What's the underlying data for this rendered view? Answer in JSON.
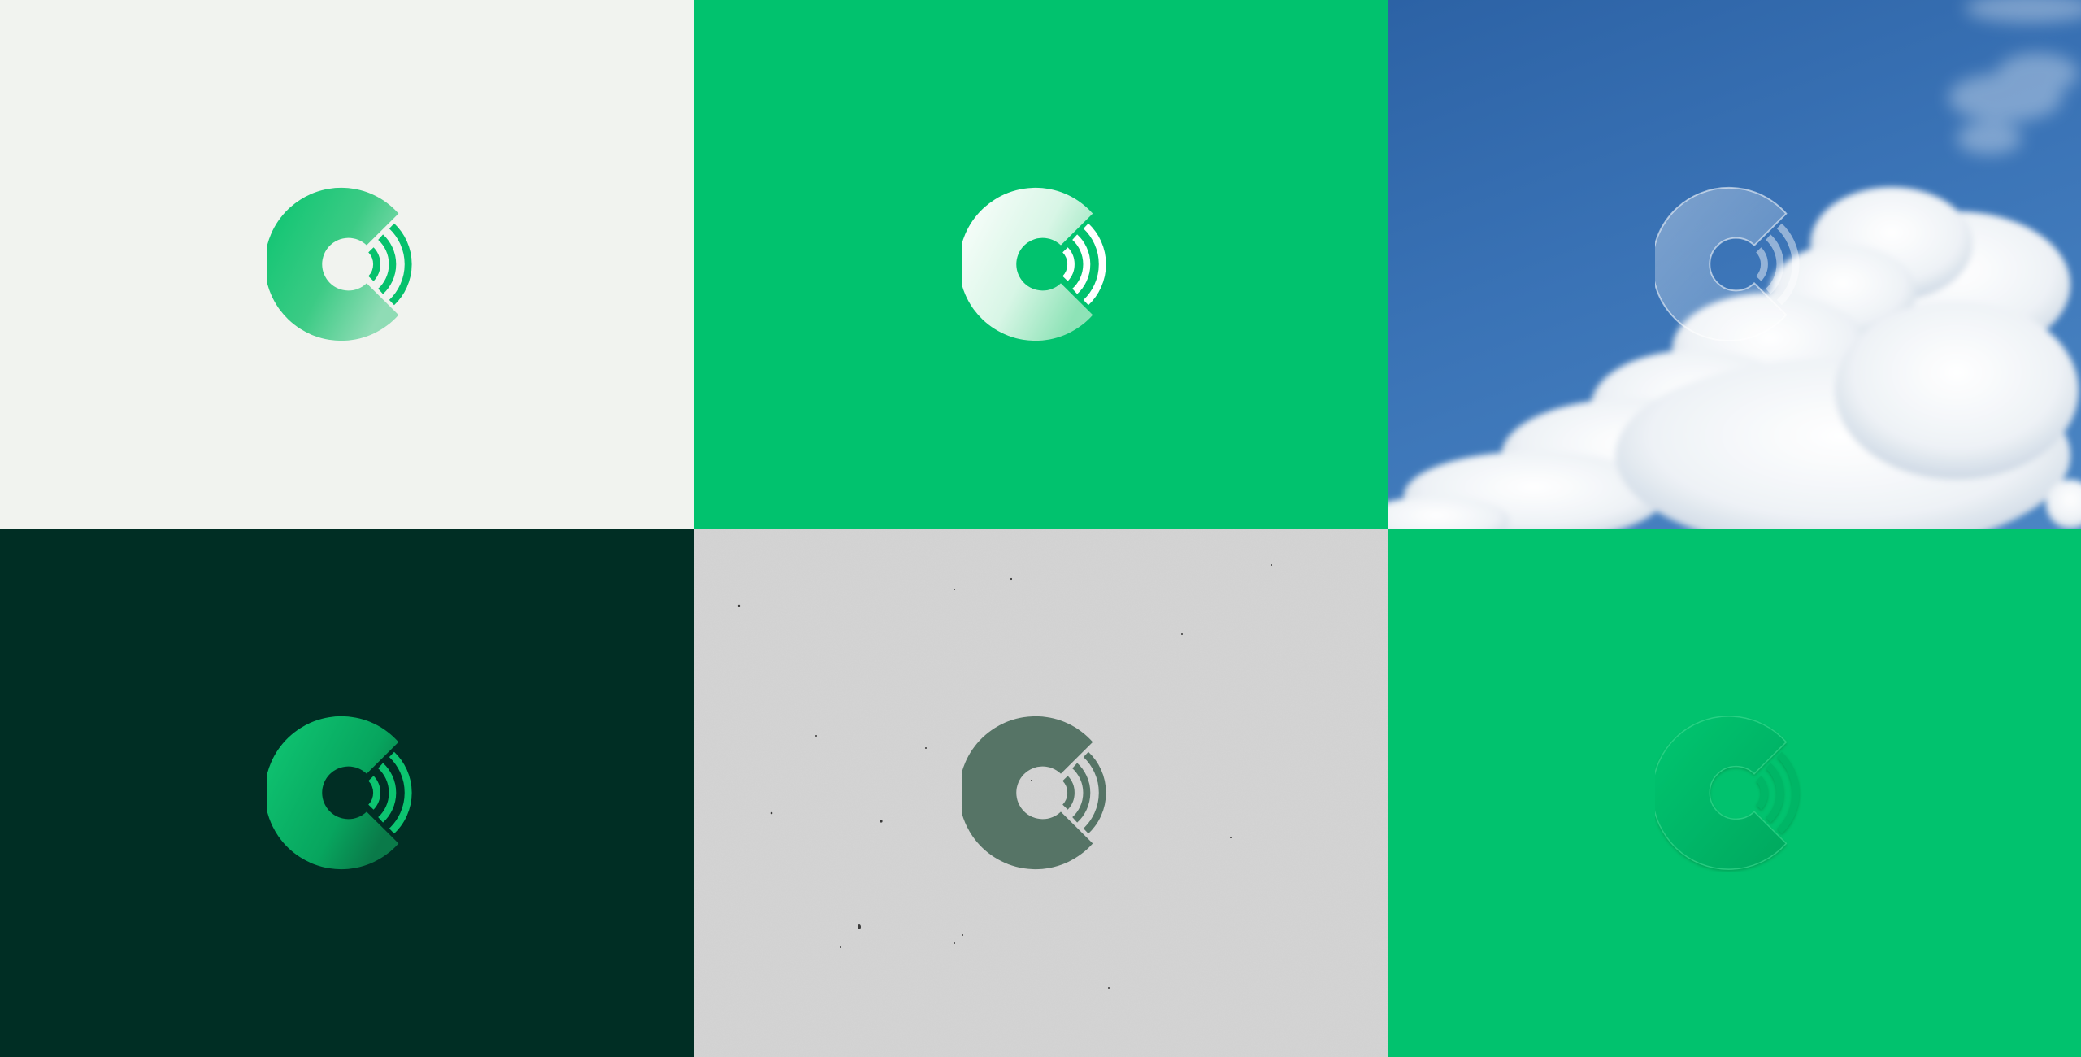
{
  "tiles": [
    {
      "name": "logo-on-light",
      "background": "#f1f3ef",
      "variant": "green-gradient"
    },
    {
      "name": "logo-on-green",
      "background": "#01c26e",
      "variant": "white-gradient"
    },
    {
      "name": "logo-on-sky",
      "background": "#3a73b6",
      "variant": "frosted-glass"
    },
    {
      "name": "logo-on-dark",
      "background": "#002e24",
      "variant": "green-gradient"
    },
    {
      "name": "logo-on-paper",
      "background": "#d4d4d4",
      "variant": "muted-green"
    },
    {
      "name": "logo-on-green-embossed",
      "background": "#01c26e",
      "variant": "embossed"
    }
  ],
  "logo": {
    "icon": "disc-signal-icon"
  },
  "colors": {
    "brand_green": "#01c26e",
    "dark_green": "#002e24",
    "muted_green": "#557466"
  }
}
